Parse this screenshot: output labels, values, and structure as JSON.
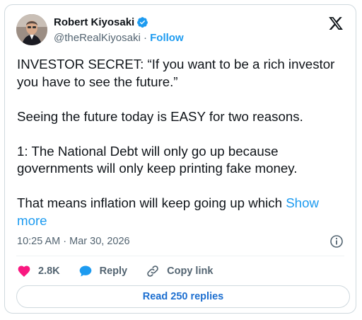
{
  "author": {
    "name": "Robert Kiyosaki",
    "handle": "@theRealKiyosaki",
    "separator": "·",
    "follow_label": "Follow"
  },
  "tweet": {
    "lines": [
      "INVESTOR SECRET:  “If you want to be a rich investor you have to see the future.”",
      "Seeing the future today is EASY for two reasons.",
      "1:  The National Debt will only go up because governments will only keep printing fake money.",
      "That means inflation will keep going up which"
    ],
    "show_more_label": "Show more"
  },
  "meta": {
    "timestamp": "10:25 AM · Mar 30, 2026"
  },
  "actions": {
    "likes_count": "2.8K",
    "reply_label": "Reply",
    "copy_link_label": "Copy link"
  },
  "read_replies_label": "Read 250 replies",
  "colors": {
    "accent": "#1d9bf0",
    "like": "#f91880",
    "reply_icon": "#1d9bf0",
    "text": "#0f1419",
    "muted": "#536471",
    "border": "#cfd9de"
  },
  "icons": {
    "verified": "verified-badge-icon",
    "platform": "x-logo-icon",
    "info": "info-icon",
    "like": "heart-icon",
    "reply": "speech-bubble-icon",
    "copy_link": "link-icon"
  }
}
